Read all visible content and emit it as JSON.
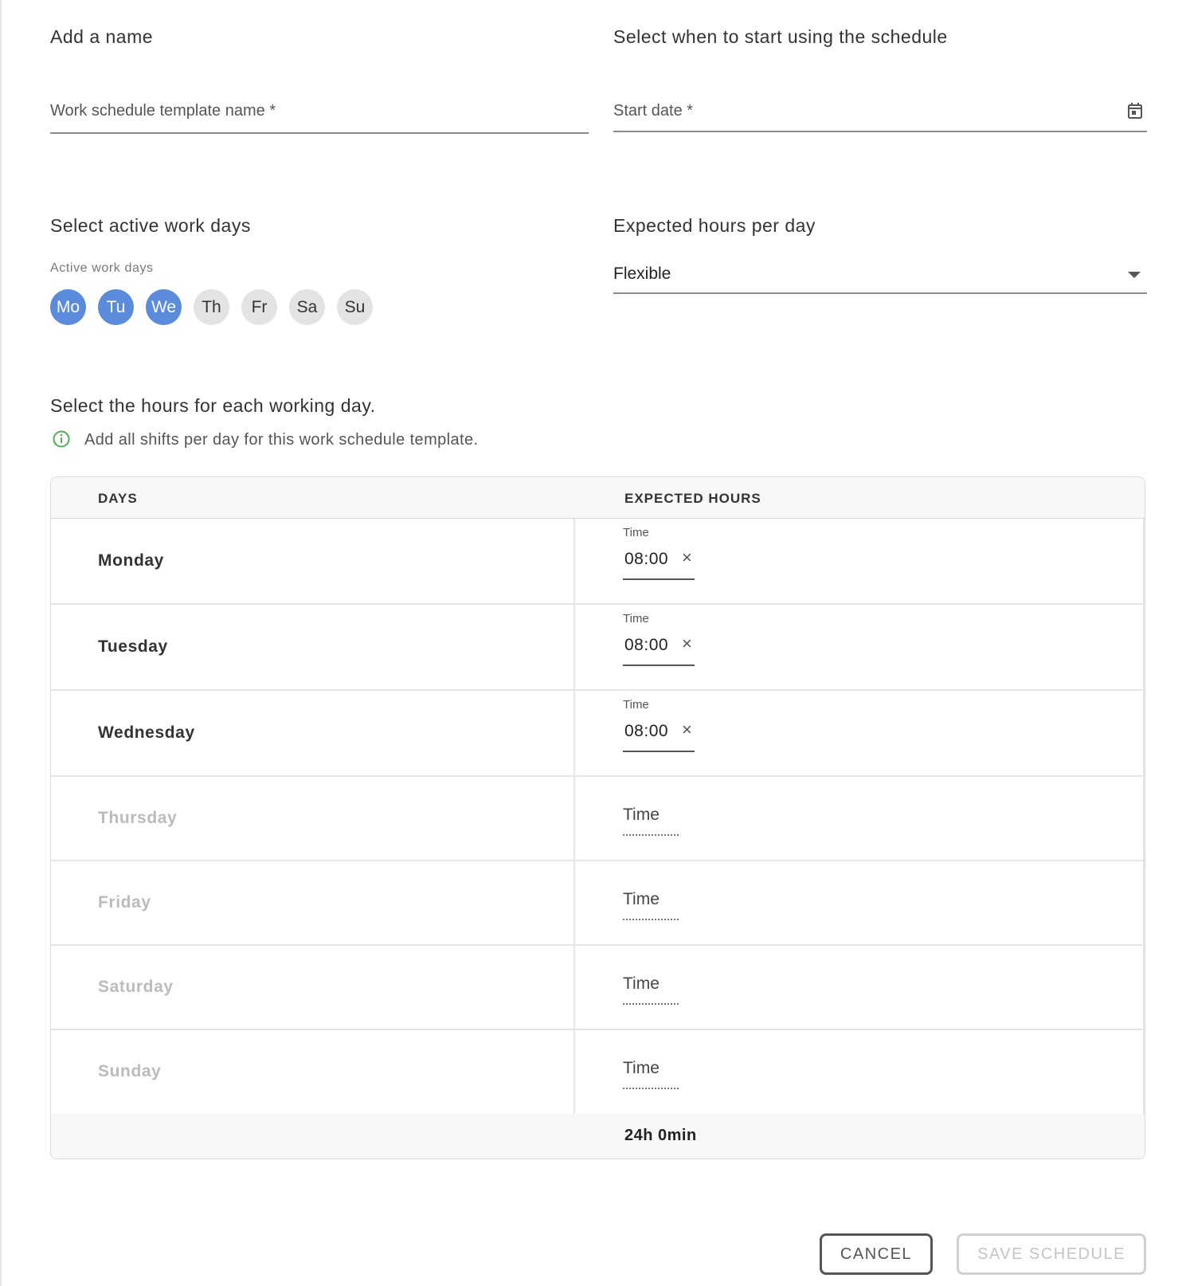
{
  "name_section": {
    "title": "Add a name",
    "field_label": "Work schedule template name *"
  },
  "start_section": {
    "title": "Select when to start using the schedule",
    "field_label": "Start date *",
    "icon": "calendar-icon"
  },
  "workdays_section": {
    "title": "Select active work days",
    "label": "Active work days",
    "days": [
      {
        "label": "Mo",
        "active": true
      },
      {
        "label": "Tu",
        "active": true
      },
      {
        "label": "We",
        "active": true
      },
      {
        "label": "Th",
        "active": false
      },
      {
        "label": "Fr",
        "active": false
      },
      {
        "label": "Sa",
        "active": false
      },
      {
        "label": "Su",
        "active": false
      }
    ],
    "active_color": "#5b8cdc",
    "inactive_color": "#e3e3e3"
  },
  "hours_section": {
    "title": "Expected hours per day",
    "selected": "Flexible",
    "icon": "caret-down-icon"
  },
  "schedule_section": {
    "title": "Select the hours for each working day.",
    "info": "Add all shifts per day for this work schedule template.",
    "info_icon": "info-icon",
    "info_color": "#4caf50"
  },
  "table": {
    "headers": {
      "days": "DAYS",
      "expected_hours": "EXPECTED HOURS"
    },
    "rows": [
      {
        "day": "Monday",
        "active": true,
        "time_label": "Time",
        "time_value": "08:00"
      },
      {
        "day": "Tuesday",
        "active": true,
        "time_label": "Time",
        "time_value": "08:00"
      },
      {
        "day": "Wednesday",
        "active": true,
        "time_label": "Time",
        "time_value": "08:00"
      },
      {
        "day": "Thursday",
        "active": false,
        "time_label": "Time",
        "time_value": ""
      },
      {
        "day": "Friday",
        "active": false,
        "time_label": "Time",
        "time_value": ""
      },
      {
        "day": "Saturday",
        "active": false,
        "time_label": "Time",
        "time_value": ""
      },
      {
        "day": "Sunday",
        "active": false,
        "time_label": "Time",
        "time_value": ""
      }
    ],
    "total": "24h 0min",
    "clear_glyph": "×"
  },
  "buttons": {
    "cancel": "CANCEL",
    "save": "SAVE SCHEDULE"
  }
}
